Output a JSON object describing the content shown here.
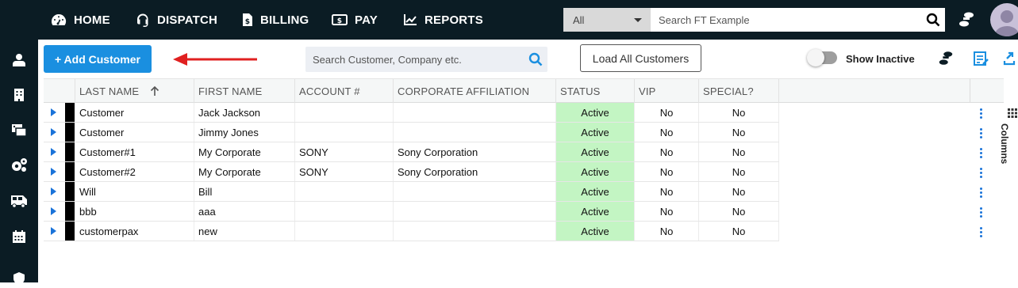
{
  "topnav": {
    "items": [
      {
        "label": "HOME",
        "icon": "dashboard-icon"
      },
      {
        "label": "DISPATCH",
        "icon": "headset-icon"
      },
      {
        "label": "BILLING",
        "icon": "invoice-icon"
      },
      {
        "label": "PAY",
        "icon": "money-icon"
      },
      {
        "label": "REPORTS",
        "icon": "chart-icon"
      }
    ],
    "search_category": "All",
    "search_placeholder": "Search FT Example"
  },
  "toolbar": {
    "add_label": "+ Add Customer",
    "search_placeholder": "Search Customer, Company etc.",
    "load_label": "Load All Customers",
    "show_inactive_label": "Show Inactive",
    "show_inactive_on": false
  },
  "grid": {
    "columns": [
      "LAST NAME",
      "FIRST NAME",
      "ACCOUNT #",
      "CORPORATE AFFILIATION",
      "STATUS",
      "VIP",
      "SPECIAL?"
    ],
    "sort_icon": "sort-ascending-icon",
    "rows": [
      {
        "last": "Customer",
        "first": "Jack Jackson",
        "account": "",
        "corp": "",
        "status": "Active",
        "vip": "No",
        "special": "No"
      },
      {
        "last": "Customer",
        "first": "Jimmy Jones",
        "account": "",
        "corp": "",
        "status": "Active",
        "vip": "No",
        "special": "No"
      },
      {
        "last": "Customer#1",
        "first": "My Corporate",
        "account": "SONY",
        "corp": "Sony Corporation",
        "status": "Active",
        "vip": "No",
        "special": "No"
      },
      {
        "last": "Customer#2",
        "first": "My Corporate",
        "account": "SONY",
        "corp": "Sony Corporation",
        "status": "Active",
        "vip": "No",
        "special": "No"
      },
      {
        "last": "Will",
        "first": "Bill",
        "account": "",
        "corp": "",
        "status": "Active",
        "vip": "No",
        "special": "No"
      },
      {
        "last": "bbb",
        "first": "aaa",
        "account": "",
        "corp": "",
        "status": "Active",
        "vip": "No",
        "special": "No"
      },
      {
        "last": "customerpax",
        "first": "new",
        "account": "",
        "corp": "",
        "status": "Active",
        "vip": "No",
        "special": "No"
      }
    ],
    "columns_panel_label": "Columns"
  },
  "colors": {
    "nav_bg": "#0b1c24",
    "primary": "#1a8fe0",
    "active_status": "#c3f5c3",
    "arrow": "#e02020"
  }
}
